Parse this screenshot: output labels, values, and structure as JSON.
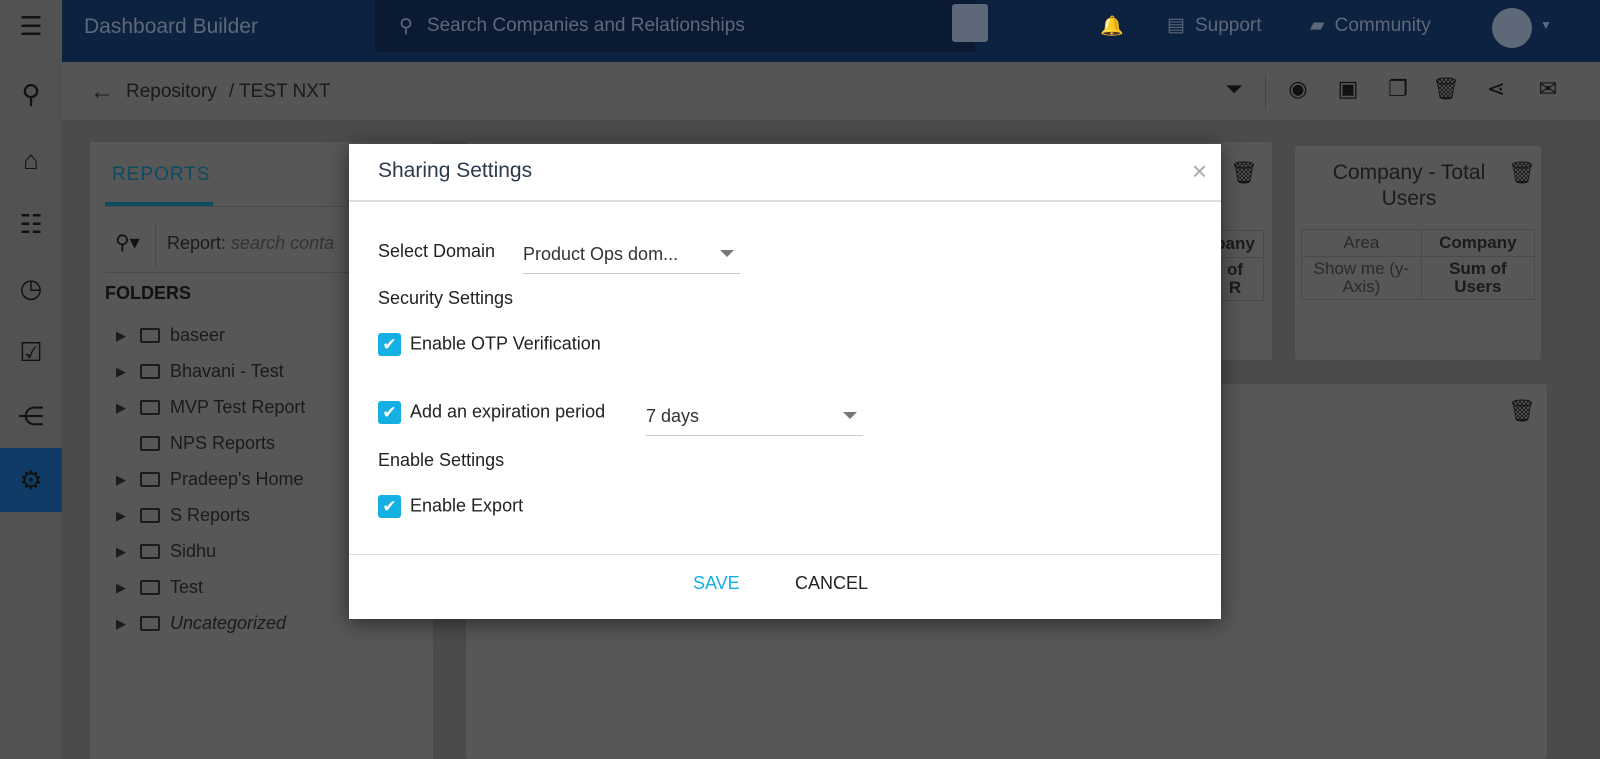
{
  "app": {
    "title": "Dashboard Builder",
    "search_placeholder": "Search Companies and Relationships",
    "support": "Support",
    "community": "Community"
  },
  "breadcrumb": {
    "root": "Repository",
    "current": "/ TEST NXT"
  },
  "left_panel": {
    "tab": "REPORTS",
    "search_label": "Report:",
    "search_placeholder": "search conta",
    "folders_heading": "FOLDERS",
    "folders": [
      {
        "name": "baseer",
        "expandable": true
      },
      {
        "name": "Bhavani - Test",
        "expandable": true
      },
      {
        "name": "MVP Test Report",
        "expandable": true
      },
      {
        "name": "NPS Reports",
        "expandable": false
      },
      {
        "name": "Pradeep's Home",
        "expandable": true
      },
      {
        "name": "S Reports",
        "expandable": true
      },
      {
        "name": "Sidhu",
        "expandable": true
      },
      {
        "name": "Test",
        "expandable": true
      },
      {
        "name": "Uncategorized",
        "expandable": true
      }
    ]
  },
  "cards": {
    "partial": {
      "col_header": "pany",
      "cell": "of",
      "cell2": "R"
    },
    "total_users": {
      "title": "Company - Total Users",
      "headers": [
        "Area",
        "Company"
      ],
      "row": [
        "Show me (y-Axis)",
        "Sum of Users"
      ]
    }
  },
  "modal": {
    "title": "Sharing Settings",
    "close": "×",
    "select_domain_label": "Select Domain",
    "domain_value": "Product Ops dom...",
    "security_heading": "Security Settings",
    "otp_label": "Enable OTP Verification",
    "otp_checked": true,
    "expiration_label": "Add an expiration period",
    "expiration_checked": true,
    "expiration_value": "7 days",
    "enable_heading": "Enable Settings",
    "export_label": "Enable Export",
    "export_checked": true,
    "save": "SAVE",
    "cancel": "CANCEL"
  },
  "colors": {
    "accent": "#15b0e3",
    "topbar": "#0d2140",
    "active_rail": "#0f3b66"
  }
}
